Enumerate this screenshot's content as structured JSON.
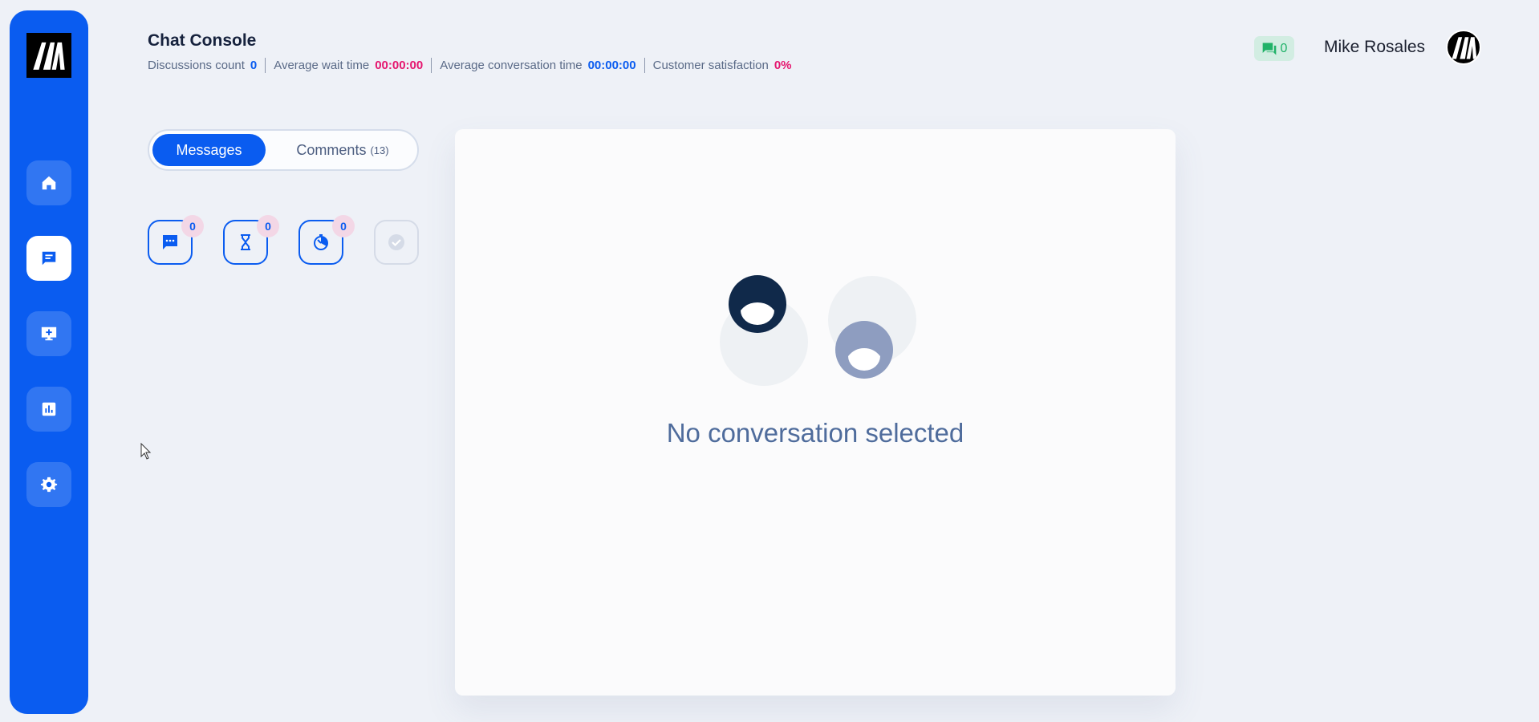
{
  "app": {
    "title": "Chat Console"
  },
  "stats": [
    {
      "label": "Discussions count",
      "value": "0",
      "color": "blue"
    },
    {
      "label": "Average wait time",
      "value": "00:00:00",
      "color": "pink"
    },
    {
      "label": "Average conversation time",
      "value": "00:00:00",
      "color": "blue"
    },
    {
      "label": "Customer satisfaction",
      "value": "0%",
      "color": "pink"
    }
  ],
  "header": {
    "notification_count": "0",
    "user_name": "Mike Rosales"
  },
  "sidebar": {
    "items": [
      {
        "name": "home",
        "icon": "home-icon",
        "active": false
      },
      {
        "name": "chat",
        "icon": "chat-icon",
        "active": true
      },
      {
        "name": "monitor",
        "icon": "monitor-plus-icon",
        "active": false
      },
      {
        "name": "reports",
        "icon": "bar-chart-icon",
        "active": false
      },
      {
        "name": "settings",
        "icon": "gear-icon",
        "active": false
      }
    ]
  },
  "tabs": {
    "messages_label": "Messages",
    "comments_label": "Comments",
    "comments_count": "(13)"
  },
  "filters": [
    {
      "icon": "chat-dots-icon",
      "count": "0"
    },
    {
      "icon": "hourglass-icon",
      "count": "0"
    },
    {
      "icon": "timer-icon",
      "count": "0"
    },
    {
      "icon": "check-circle-icon",
      "count": null
    }
  ],
  "main": {
    "empty_message": "No conversation selected"
  },
  "colors": {
    "primary": "#0a5cf0",
    "pink": "#e5176f",
    "success": "#21b268"
  }
}
